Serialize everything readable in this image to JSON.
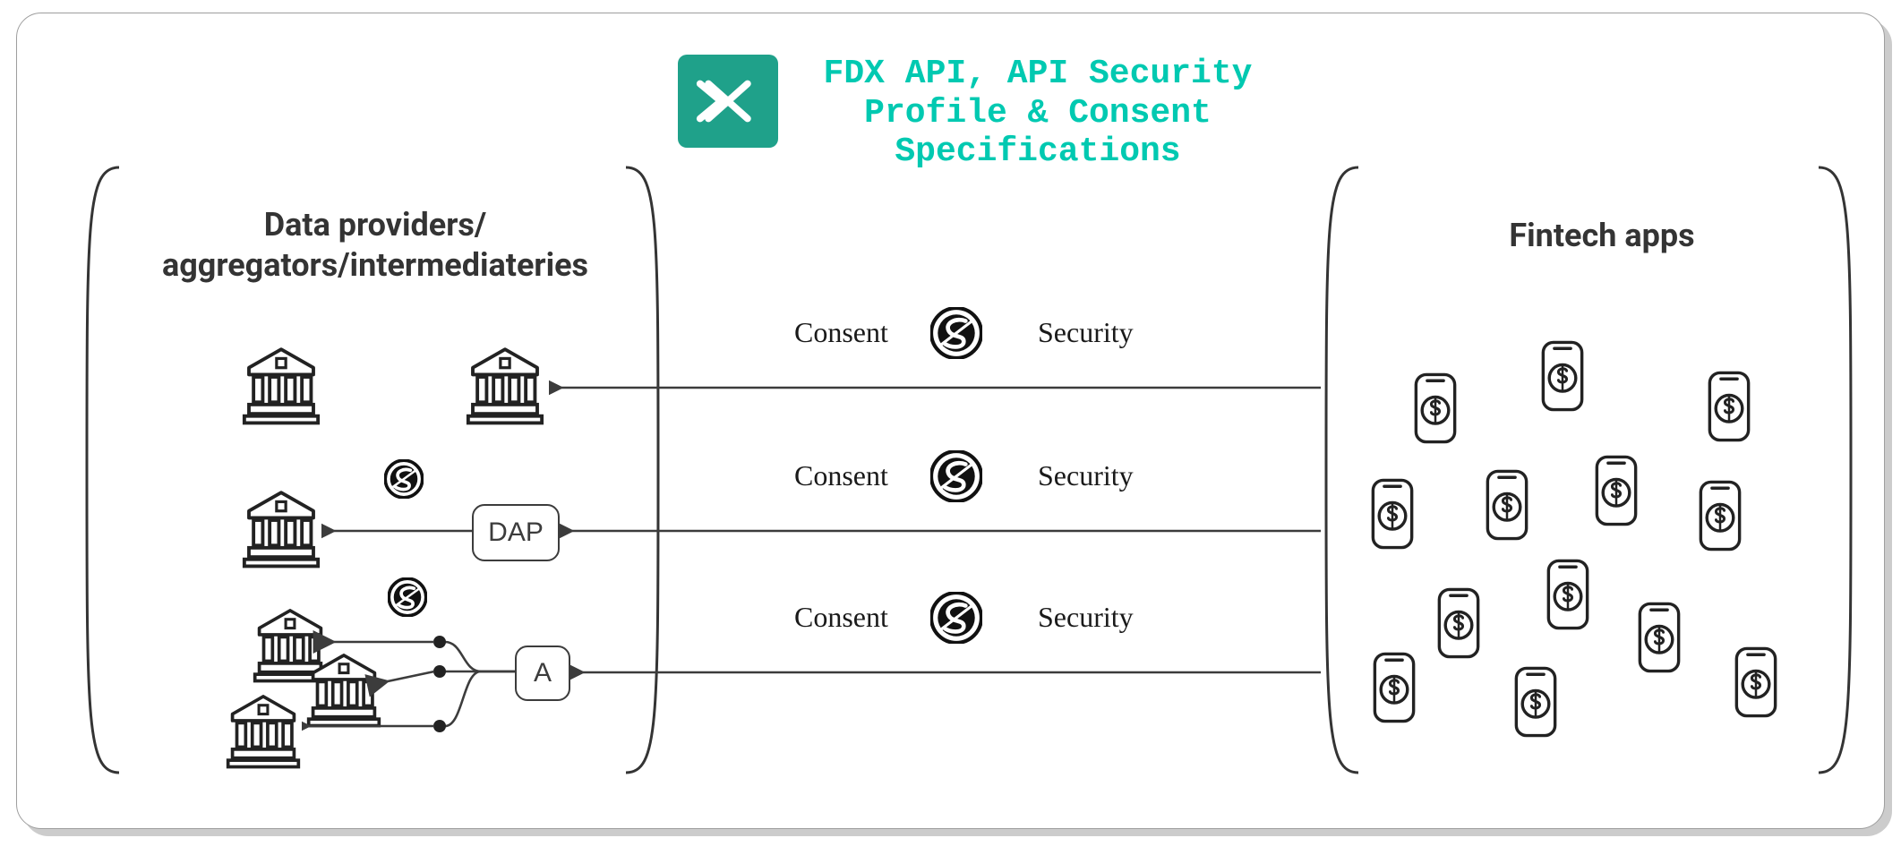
{
  "header": {
    "title_line1": "FDX API, API Security",
    "title_line2": "Profile & Consent",
    "title_line3": "Specifications",
    "logo_name": "fdx-logo"
  },
  "left_panel": {
    "heading_line1": "Data providers/",
    "heading_line2": "aggregators/intermediateries",
    "nodes": {
      "dap_label": "DAP",
      "aggregator_label": "A"
    },
    "bank_count": 6,
    "api_badge_count": 2
  },
  "right_panel": {
    "heading": "Fintech apps",
    "phone_app_count": 13
  },
  "flows": [
    {
      "consent_label": "Consent",
      "security_label": "Security"
    },
    {
      "consent_label": "Consent",
      "security_label": "Security"
    },
    {
      "consent_label": "Consent",
      "security_label": "Security"
    }
  ],
  "colors": {
    "accent_teal": "#00c9b1",
    "logo_bg": "#1fa18a",
    "stroke": "#3c3c3c"
  }
}
